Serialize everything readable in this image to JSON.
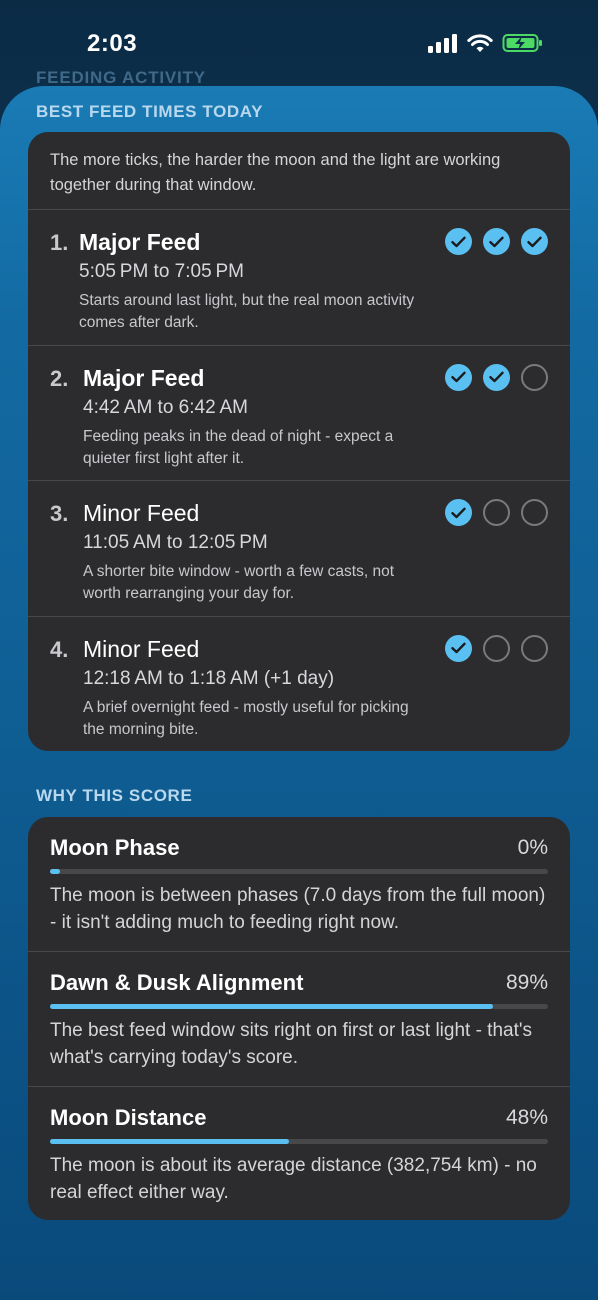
{
  "status_bar": {
    "time": "2:03",
    "icons": [
      "signal-icon",
      "wifi-icon",
      "battery-charging-icon"
    ]
  },
  "behind_title": "FEEDING ACTIVITY",
  "best_feed": {
    "title": "BEST FEED TIMES TODAY",
    "intro": "The more ticks, the harder the moon and the light are working together during that window.",
    "items": [
      {
        "rank": "1.",
        "name": "Major Feed",
        "major": true,
        "time": "5:05 PM to 7:05 PM",
        "desc": "Starts around last light, but the real moon activity comes after dark.",
        "ticks": 3
      },
      {
        "rank": "2.",
        "name": "Major Feed",
        "major": true,
        "time": "4:42 AM to 6:42 AM",
        "desc": "Feeding peaks in the dead of night - expect a quieter first light after it.",
        "ticks": 2
      },
      {
        "rank": "3.",
        "name": "Minor Feed",
        "major": false,
        "time": "11:05 AM to 12:05 PM",
        "desc": "A shorter bite window - worth a few casts, not worth rearranging your day for.",
        "ticks": 1
      },
      {
        "rank": "4.",
        "name": "Minor Feed",
        "major": false,
        "time": "12:18 AM to 1:18 AM (+1 day)",
        "desc": "A brief overnight feed - mostly useful for picking the morning bite.",
        "ticks": 1
      }
    ]
  },
  "why_score": {
    "title": "WHY THIS SCORE",
    "items": [
      {
        "label": "Moon Phase",
        "percent": "0%",
        "fraction": 0.02,
        "desc": "The moon is between phases (7.0 days from the full moon) - it isn't adding much to feeding right now."
      },
      {
        "label": "Dawn & Dusk Alignment",
        "percent": "89%",
        "fraction": 0.89,
        "desc": "The best feed window sits right on first or last light - that's what's carrying today's score."
      },
      {
        "label": "Moon Distance",
        "percent": "48%",
        "fraction": 0.48,
        "desc": "The moon is about its average distance (382,754 km) - no real effect either way."
      }
    ]
  },
  "colors": {
    "accent": "#5ac0f2",
    "card": "#2c2c2e",
    "battery": "#4cd964"
  }
}
